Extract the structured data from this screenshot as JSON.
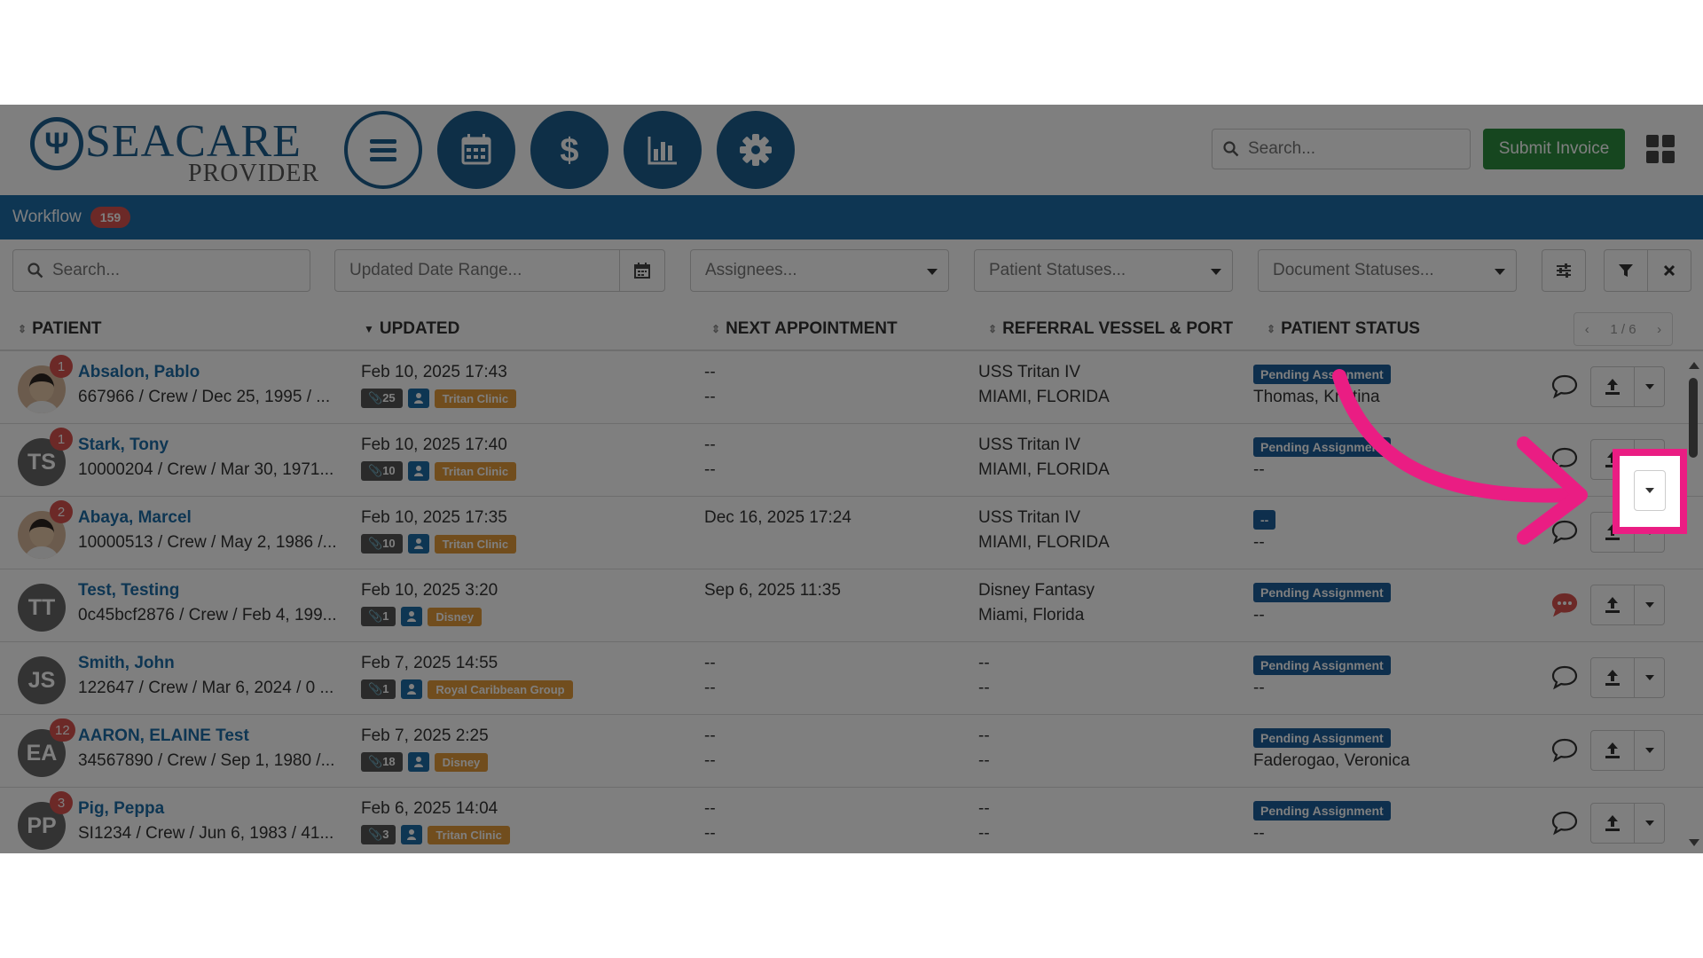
{
  "header": {
    "logo_text": "SEACARE",
    "logo_subtext": "PROVIDER",
    "search_placeholder": "Search...",
    "submit_invoice_label": "Submit Invoice",
    "nav_icons": [
      "menu-icon",
      "calendar-icon",
      "dollar-icon",
      "bar-chart-icon",
      "gear-icon"
    ]
  },
  "workflow": {
    "label": "Workflow",
    "count": "159"
  },
  "filters": {
    "search_placeholder": "Search...",
    "date_range_placeholder": "Updated Date Range...",
    "assignees_placeholder": "Assignees...",
    "patient_statuses_placeholder": "Patient Statuses...",
    "document_statuses_placeholder": "Document Statuses..."
  },
  "table": {
    "columns": [
      "PATIENT",
      "UPDATED",
      "NEXT APPOINTMENT",
      "REFERRAL VESSEL & PORT",
      "PATIENT STATUS"
    ],
    "pager": "1 / 6",
    "rows": [
      {
        "name": "Absalon, Pablo",
        "info": "667966 / Crew / Dec 25, 1995 / ...",
        "initials": "",
        "badge": "1",
        "updated": "Feb 10, 2025 17:43",
        "docs": "25",
        "org": "Tritan Clinic",
        "appt_1": "--",
        "appt_2": "--",
        "vessel": "USS Tritan IV",
        "port": "MIAMI, FLORIDA",
        "status": "Pending Assignment",
        "assignee": "Thomas, Kristina"
      },
      {
        "name": "Stark, Tony",
        "info": "10000204 / Crew / Mar 30, 1971...",
        "initials": "TS",
        "badge": "1",
        "updated": "Feb 10, 2025 17:40",
        "docs": "10",
        "org": "Tritan Clinic",
        "appt_1": "--",
        "appt_2": "--",
        "vessel": "USS Tritan IV",
        "port": "MIAMI, FLORIDA",
        "status": "Pending Assignment",
        "assignee": "--"
      },
      {
        "name": "Abaya, Marcel",
        "info": "10000513 / Crew / May 2, 1986 /...",
        "initials": "",
        "badge": "2",
        "updated": "Feb 10, 2025 17:35",
        "docs": "10",
        "org": "Tritan Clinic",
        "appt_1": "Dec 16, 2025 17:24",
        "appt_2": "",
        "vessel": "USS Tritan IV",
        "port": "MIAMI, FLORIDA",
        "status": "--",
        "assignee": "--"
      },
      {
        "name": "Test, Testing",
        "info": "0c45bcf2876 / Crew / Feb 4, 199...",
        "initials": "TT",
        "badge": "",
        "updated": "Feb 10, 2025 3:20",
        "docs": "1",
        "org": "Disney",
        "appt_1": "Sep 6, 2025 11:35",
        "appt_2": "",
        "vessel": "Disney Fantasy",
        "port": "Miami, Florida",
        "status": "Pending Assignment",
        "assignee": "--"
      },
      {
        "name": "Smith, John",
        "info": "122647 / Crew / Mar 6, 2024 / 0 ...",
        "initials": "JS",
        "badge": "",
        "updated": "Feb 7, 2025 14:55",
        "docs": "1",
        "org": "Royal Caribbean Group",
        "appt_1": "--",
        "appt_2": "--",
        "vessel": "--",
        "port": "--",
        "status": "Pending Assignment",
        "assignee": "--"
      },
      {
        "name": "AARON, ELAINE Test",
        "info": "34567890 / Crew / Sep 1, 1980 /...",
        "initials": "EA",
        "badge": "12",
        "updated": "Feb 7, 2025 2:25",
        "docs": "18",
        "org": "Disney",
        "appt_1": "--",
        "appt_2": "--",
        "vessel": "--",
        "port": "--",
        "status": "Pending Assignment",
        "assignee": "Faderogao, Veronica"
      },
      {
        "name": "Pig, Peppa",
        "info": "SI1234 / Crew / Jun 6, 1983 / 41...",
        "initials": "PP",
        "badge": "3",
        "updated": "Feb 6, 2025 14:04",
        "docs": "3",
        "org": "Tritan Clinic",
        "appt_1": "--",
        "appt_2": "--",
        "vessel": "--",
        "port": "--",
        "status": "Pending Assignment",
        "assignee": "--"
      }
    ]
  },
  "colors": {
    "brand_blue": "#1c5f8f",
    "workflow_bar": "#1d6ca6",
    "submit_green": "#2d8c3e",
    "highlight_pink": "#ea1d83",
    "org_chip": "#e29a3a",
    "badge_red": "#d9534f"
  }
}
